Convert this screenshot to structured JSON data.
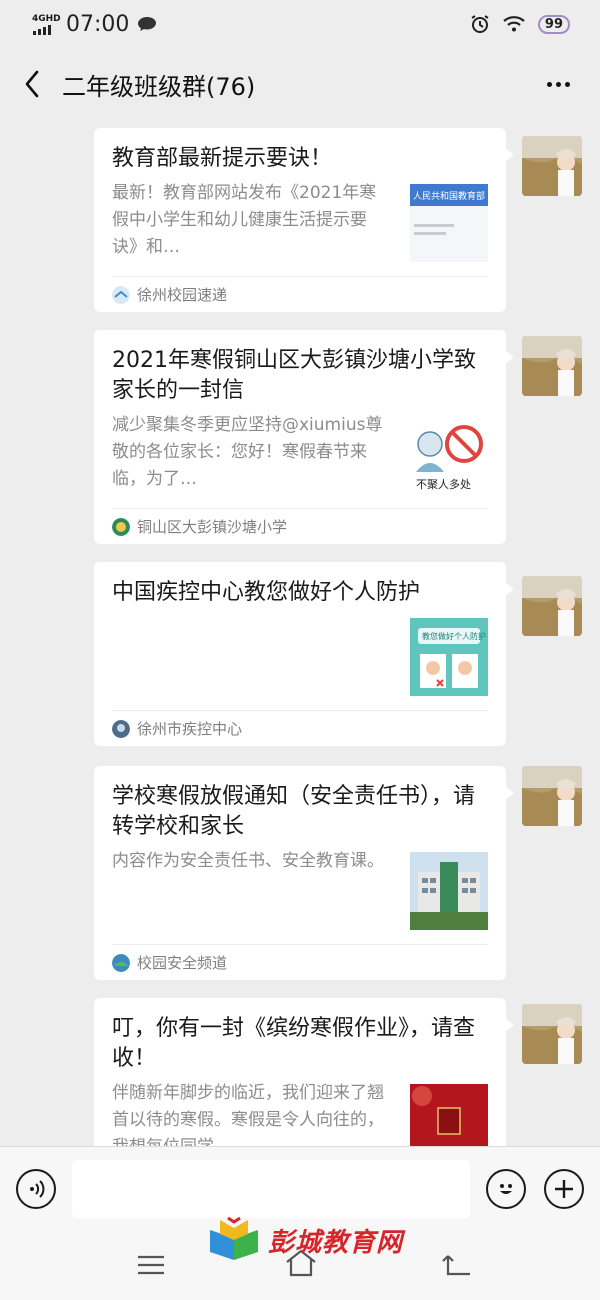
{
  "status_bar": {
    "network": "4GHD",
    "time": "07:00",
    "battery": "99"
  },
  "header": {
    "title": "二年级班级群(76)"
  },
  "messages": [
    {
      "title": "教育部最新提示要诀！",
      "description": "最新！教育部网站发布《2021年寒假中小学生和幼儿健康生活提示要诀》和…",
      "thumb_text": "人民共和国教育部",
      "source": "徐州校园速递"
    },
    {
      "title": "2021年寒假铜山区大彭镇沙塘小学致家长的一封信",
      "description": "减少聚集冬季更应坚持@xiumius尊敬的各位家长：您好！寒假春节来临，为了…",
      "thumb_text": "不聚人多处",
      "source": "铜山区大彭镇沙塘小学"
    },
    {
      "title": "中国疾控中心教您做好个人防护",
      "description": "",
      "thumb_text": "教您做好个人防护",
      "source": "徐州市疾控中心"
    },
    {
      "title": "学校寒假放假通知（安全责任书），请转学校和家长",
      "description": "内容作为安全责任书、安全教育课。",
      "thumb_text": "",
      "source": "校园安全频道"
    },
    {
      "title": "叮，你有一封《缤纷寒假作业》，请查收！",
      "description": "伴随新年脚步的临近，我们迎来了翘首以待的寒假。寒假是令人向往的，我想每位同学…",
      "thumb_text": "",
      "source": ""
    }
  ],
  "input": {
    "placeholder": ""
  },
  "watermark": {
    "text": "彭城教育网"
  },
  "colors": {
    "background": "#ededed",
    "card": "#ffffff",
    "watermark_red": "#d6262b"
  }
}
